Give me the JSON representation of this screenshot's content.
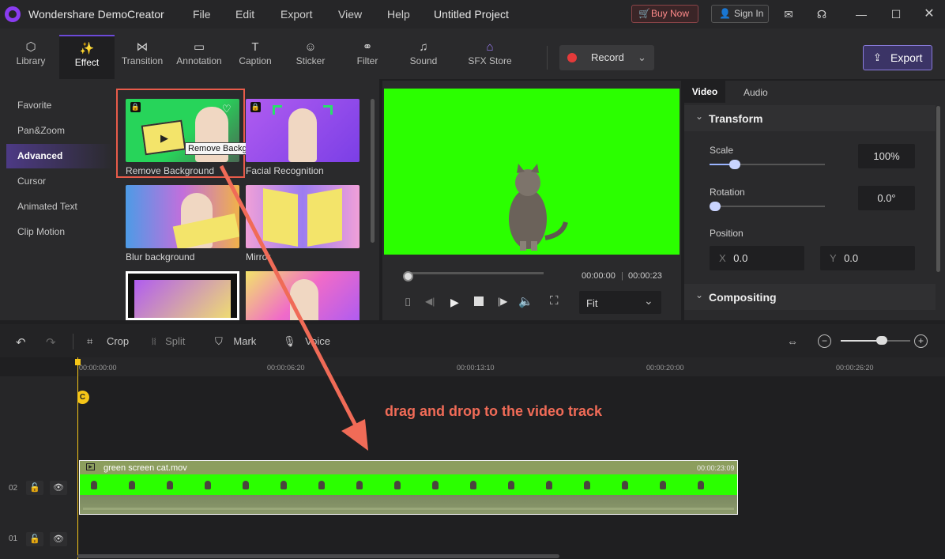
{
  "app": {
    "title": "Wondershare DemoCreator",
    "menu": [
      "File",
      "Edit",
      "Export",
      "View",
      "Help"
    ],
    "project_name": "Untitled Project",
    "buy_now": "Buy Now",
    "sign_in": "Sign In"
  },
  "toolbar": {
    "tabs": [
      {
        "label": "Library",
        "icon": "library-icon"
      },
      {
        "label": "Effect",
        "icon": "effect-icon"
      },
      {
        "label": "Transition",
        "icon": "transition-icon"
      },
      {
        "label": "Annotation",
        "icon": "annotation-icon"
      },
      {
        "label": "Caption",
        "icon": "caption-icon"
      },
      {
        "label": "Sticker",
        "icon": "sticker-icon"
      },
      {
        "label": "Filter",
        "icon": "filter-icon"
      },
      {
        "label": "Sound",
        "icon": "sound-icon"
      },
      {
        "label": "SFX Store",
        "icon": "sfx-store-icon"
      }
    ],
    "record_label": "Record",
    "export_label": "Export"
  },
  "categories": [
    "Favorite",
    "Pan&Zoom",
    "Advanced",
    "Cursor",
    "Animated Text",
    "Clip Motion"
  ],
  "effects": {
    "items": [
      "Remove Background",
      "Facial Recognition",
      "Blur background",
      "Mirror"
    ],
    "tooltip": "Remove Background"
  },
  "preview": {
    "current_time": "00:00:00",
    "total_time": "00:00:23",
    "fit_label": "Fit"
  },
  "properties": {
    "tabs": [
      "Video",
      "Audio"
    ],
    "transform_title": "Transform",
    "scale_label": "Scale",
    "scale_value": "100%",
    "rotation_label": "Rotation",
    "rotation_value": "0.0°",
    "position_label": "Position",
    "x_label": "X",
    "x_value": "0.0",
    "y_label": "Y",
    "y_value": "0.0",
    "compositing_title": "Compositing"
  },
  "timeline_toolbar": {
    "crop": "Crop",
    "split": "Split",
    "mark": "Mark",
    "voice": "Voice"
  },
  "timeline": {
    "ruler": [
      "00:00:00:00",
      "00:00:06:20",
      "00:00:13:10",
      "00:00:20:00",
      "00:00:26:20"
    ],
    "tracks": [
      "02",
      "01"
    ],
    "clip_name": "green screen cat.mov",
    "clip_duration": "00:00:23:09",
    "annotation": "drag and drop to the video track"
  },
  "colors": {
    "accent": "#6c4ad8",
    "green_screen": "#2bff00",
    "annotation_red": "#f06b57",
    "playhead": "#f5c518"
  }
}
